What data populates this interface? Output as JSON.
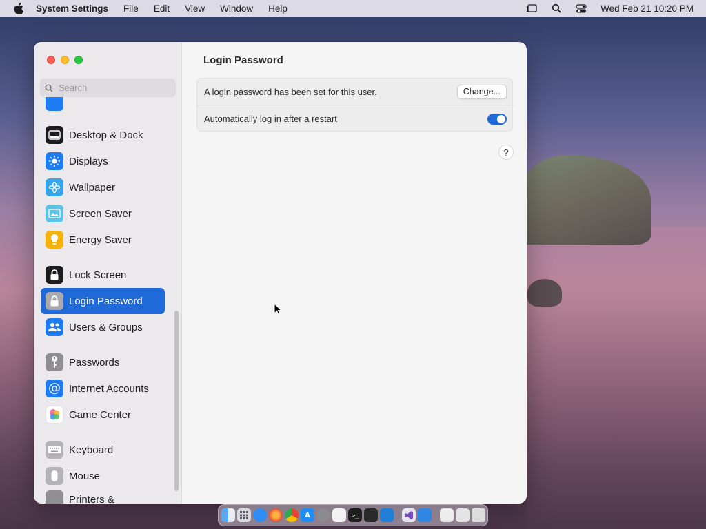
{
  "menubar": {
    "app_name": "System Settings",
    "menus": [
      "File",
      "Edit",
      "View",
      "Window",
      "Help"
    ],
    "datetime": "Wed Feb 21  10:20 PM"
  },
  "sidebar": {
    "search_placeholder": "Search",
    "items": [
      {
        "label": "Desktop & Dock",
        "icon": "dock-icon",
        "color": "#1c1c1e"
      },
      {
        "label": "Displays",
        "icon": "sun-icon",
        "color": "#1e7cf2"
      },
      {
        "label": "Wallpaper",
        "icon": "flower-icon",
        "color": "#37a6e8"
      },
      {
        "label": "Screen Saver",
        "icon": "screensaver-icon",
        "color": "#5bc3e6"
      },
      {
        "label": "Energy Saver",
        "icon": "lightbulb-icon",
        "color": "#f5b20a"
      },
      {
        "label": "Lock Screen",
        "icon": "lock-icon",
        "color": "#1c1c1e"
      },
      {
        "label": "Login Password",
        "icon": "lock-icon",
        "color": "#8e8e93",
        "active": true
      },
      {
        "label": "Users & Groups",
        "icon": "users-icon",
        "color": "#1e7cf2"
      },
      {
        "label": "Passwords",
        "icon": "key-icon",
        "color": "#8e8e93"
      },
      {
        "label": "Internet Accounts",
        "icon": "at-icon",
        "color": "#1e7cf2"
      },
      {
        "label": "Game Center",
        "icon": "game-center-icon",
        "color": "#ffffff"
      },
      {
        "label": "Keyboard",
        "icon": "keyboard-icon",
        "color": "#9a9a9e"
      },
      {
        "label": "Mouse",
        "icon": "mouse-icon",
        "color": "#9a9a9e"
      },
      {
        "label": "Printers &",
        "icon": "printer-icon",
        "color": "#8e8e93"
      }
    ]
  },
  "main": {
    "title": "Login Password",
    "password_row_text": "A login password has been set for this user.",
    "change_button": "Change...",
    "autologin_text": "Automatically log in after a restart",
    "autologin_enabled": true,
    "help_label": "?"
  },
  "colors": {
    "accent": "#1f6ad8"
  }
}
